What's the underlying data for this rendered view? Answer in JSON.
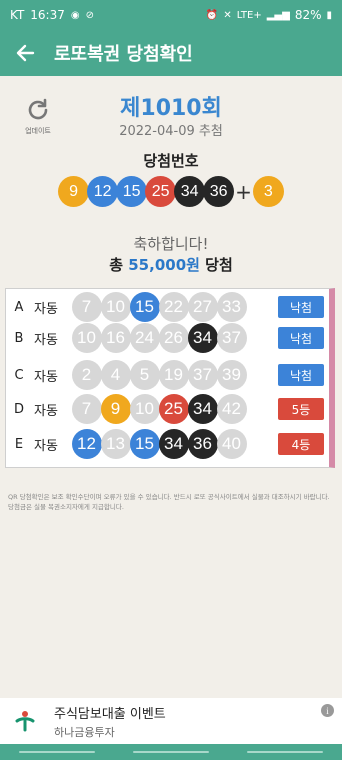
{
  "status_bar": {
    "carrier": "KT",
    "time": "16:37",
    "battery": "82%",
    "network": "LTE+"
  },
  "app_bar": {
    "title": "로또복권 당첨확인"
  },
  "refresh": {
    "label": "업데이트"
  },
  "draw": {
    "number_label": "제1010회",
    "date_label": "2022-04-09 추첨"
  },
  "winning": {
    "label": "당첨번호",
    "numbers": [
      "9",
      "12",
      "15",
      "25",
      "34",
      "36"
    ],
    "number_colors": [
      "yellow",
      "blue",
      "blue",
      "red",
      "black",
      "black"
    ],
    "bonus": "3",
    "bonus_color": "yellow"
  },
  "result_summary": {
    "congrats": "축하합니다!",
    "prefix": "총",
    "amount": "55,000원",
    "suffix": "당첨"
  },
  "ticket_rows": [
    {
      "letter": "A",
      "mode": "자동",
      "numbers": [
        "7",
        "10",
        "15",
        "22",
        "27",
        "33"
      ],
      "colors": [
        "gray",
        "gray",
        "blue",
        "gray",
        "gray",
        "gray"
      ],
      "result": "낙첨",
      "result_type": "miss"
    },
    {
      "letter": "B",
      "mode": "자동",
      "numbers": [
        "10",
        "16",
        "24",
        "26",
        "34",
        "37"
      ],
      "colors": [
        "gray",
        "gray",
        "gray",
        "gray",
        "black",
        "gray"
      ],
      "result": "낙첨",
      "result_type": "miss"
    },
    {
      "letter": "C",
      "mode": "자동",
      "numbers": [
        "2",
        "4",
        "5",
        "19",
        "37",
        "39"
      ],
      "colors": [
        "gray",
        "gray",
        "gray",
        "gray",
        "gray",
        "gray"
      ],
      "result": "낙첨",
      "result_type": "miss"
    },
    {
      "letter": "D",
      "mode": "자동",
      "numbers": [
        "7",
        "9",
        "10",
        "25",
        "34",
        "42"
      ],
      "colors": [
        "gray",
        "yellow",
        "gray",
        "red",
        "black",
        "gray"
      ],
      "result": "5등",
      "result_type": "win"
    },
    {
      "letter": "E",
      "mode": "자동",
      "numbers": [
        "12",
        "13",
        "15",
        "34",
        "36",
        "40"
      ],
      "colors": [
        "blue",
        "gray",
        "blue",
        "black",
        "black",
        "gray"
      ],
      "result": "4등",
      "result_type": "win"
    }
  ],
  "note": "QR 당첨확인은 보조 확인수단이며 오류가 있을 수 있습니다. 반드시 로또 공식사이트에서 실물과 대조하시기 바랍니다. 당첨금은 실물 복권소지자에게 지급합니다.",
  "ad": {
    "title": "주식담보대출 이벤트",
    "subtitle": "하나금융투자",
    "logo_icon": "hana-logo-icon",
    "info_icon": "info-icon"
  },
  "colors": {
    "header_bg": "#4aa88f",
    "yellow": "#f0a81e",
    "blue": "#3c83d8",
    "red": "#d94a3c",
    "black": "#262626",
    "gray": "#d7d7d7"
  }
}
